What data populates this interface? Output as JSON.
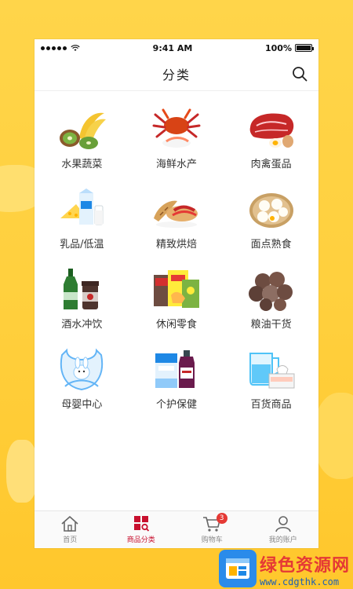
{
  "status_bar": {
    "time": "9:41 AM",
    "battery": "100%"
  },
  "nav": {
    "title": "分类"
  },
  "categories": [
    {
      "label": "水果蔬菜",
      "icon": "fruit-vegetable-icon"
    },
    {
      "label": "海鲜水产",
      "icon": "seafood-crab-icon"
    },
    {
      "label": "肉禽蛋品",
      "icon": "meat-egg-icon"
    },
    {
      "label": "乳品/低温",
      "icon": "dairy-icon"
    },
    {
      "label": "精致烘焙",
      "icon": "bakery-icon"
    },
    {
      "label": "面点熟食",
      "icon": "buns-icon"
    },
    {
      "label": "酒水冲饮",
      "icon": "drinks-icon"
    },
    {
      "label": "休闲零食",
      "icon": "snacks-icon"
    },
    {
      "label": "粮油干货",
      "icon": "dry-goods-icon"
    },
    {
      "label": "母婴中心",
      "icon": "baby-bib-icon"
    },
    {
      "label": "个护保健",
      "icon": "health-care-icon"
    },
    {
      "label": "百货商品",
      "icon": "household-goods-icon"
    }
  ],
  "tabbar": {
    "items": [
      {
        "label": "首页",
        "icon": "home-icon",
        "active": false
      },
      {
        "label": "商品分类",
        "icon": "category-icon",
        "active": true
      },
      {
        "label": "购物车",
        "icon": "cart-icon",
        "active": false,
        "badge": "3"
      },
      {
        "label": "我的账户",
        "icon": "account-icon",
        "active": false
      }
    ]
  },
  "watermark": {
    "title": "绿色资源网",
    "url": "www.cdgthk.com"
  },
  "colors": {
    "accent": "#c8102e",
    "background": "#ffd54a",
    "badge": "#e53935"
  }
}
